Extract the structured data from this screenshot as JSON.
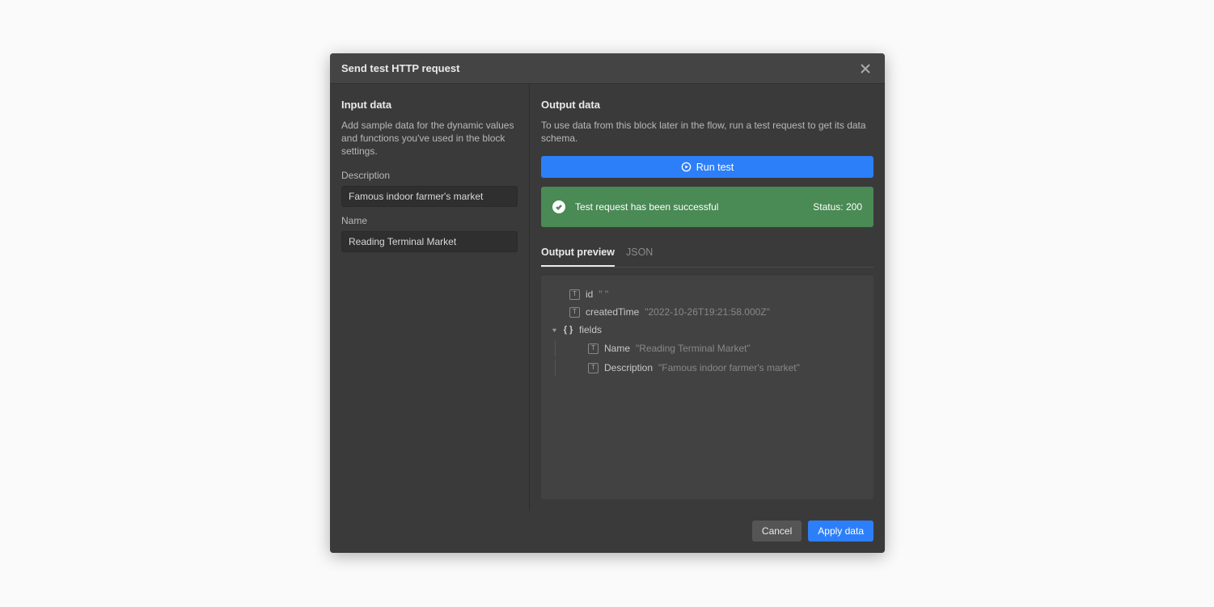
{
  "modal": {
    "title": "Send test HTTP request"
  },
  "input": {
    "title": "Input data",
    "description": "Add sample data for the dynamic values and functions you've used in the block settings.",
    "fields": [
      {
        "label": "Description",
        "value": "Famous indoor farmer's market"
      },
      {
        "label": "Name",
        "value": "Reading Terminal Market"
      }
    ]
  },
  "output": {
    "title": "Output data",
    "description": "To use data from this block later in the flow, run a test request to get its data schema.",
    "run_label": "Run test",
    "status": {
      "message": "Test request has been successful",
      "code_label": "Status: 200"
    },
    "tabs": [
      {
        "label": "Output preview",
        "active": true
      },
      {
        "label": "JSON",
        "active": false
      }
    ],
    "tree": {
      "id_key": "id",
      "id_value": "\"                              \"",
      "created_key": "createdTime",
      "created_value": "\"2022-10-26T19:21:58.000Z\"",
      "fields_key": "fields",
      "name_key": "Name",
      "name_value": "\"Reading Terminal Market\"",
      "desc_key": "Description",
      "desc_value": "\"Famous indoor farmer's market\""
    }
  },
  "footer": {
    "cancel": "Cancel",
    "apply": "Apply data"
  }
}
